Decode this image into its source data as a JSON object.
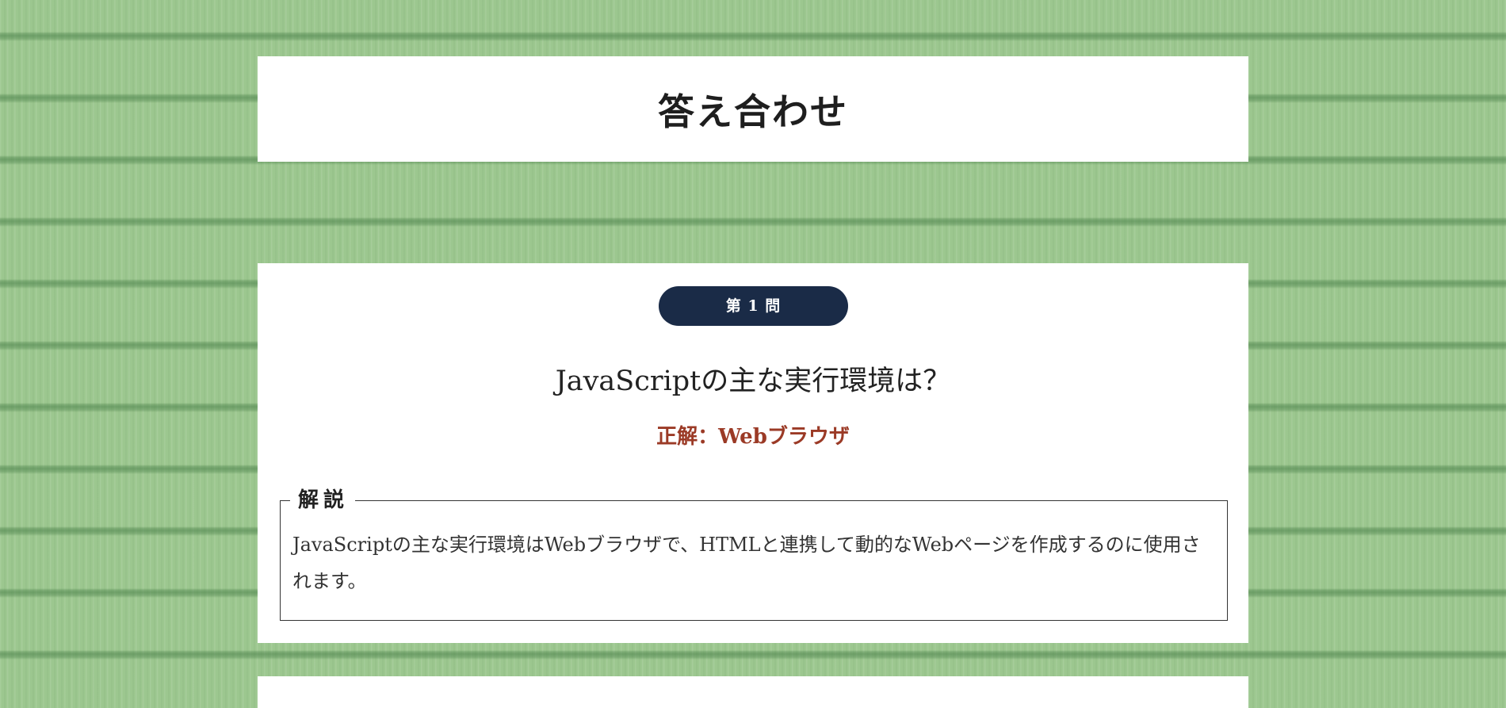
{
  "page": {
    "title": "答え合わせ"
  },
  "question": {
    "badge": "第 1 問",
    "text": "JavaScriptの主な実行環境は？",
    "answer": "正解：Webブラウザ",
    "explanation": {
      "label": "解説",
      "text": "JavaScriptの主な実行環境はWebブラウザで、HTMLと連携して動的なWebページを作成するのに使用されます。"
    }
  },
  "colors": {
    "background": "#9cc78f",
    "badge": "#1a2b47",
    "answer": "#9b3a26",
    "card": "#ffffff"
  }
}
